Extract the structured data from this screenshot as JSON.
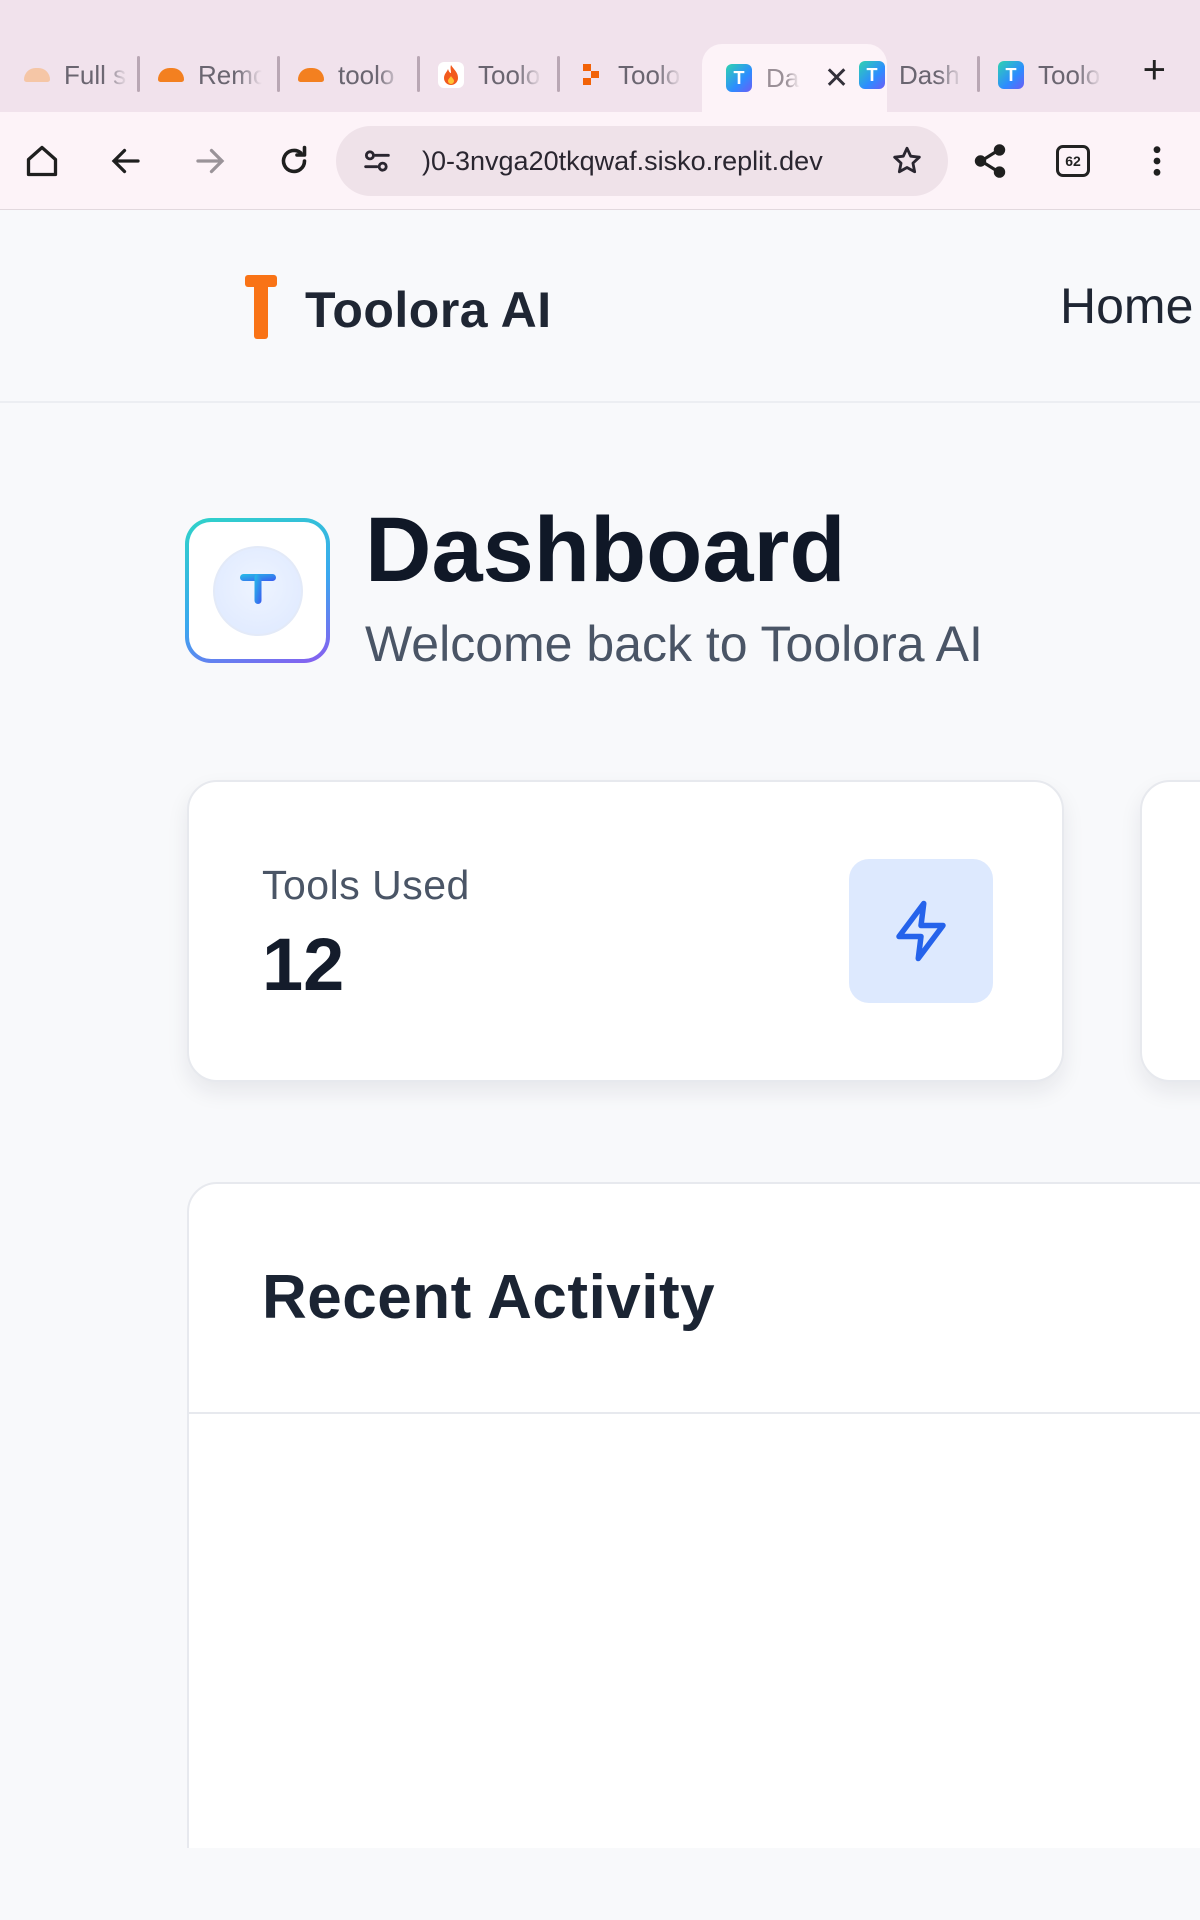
{
  "browser": {
    "tabs": [
      {
        "title": "Full s",
        "favicon": "cloudflare-faded-icon",
        "active": false
      },
      {
        "title": "Remo",
        "favicon": "cloudflare-icon",
        "active": false
      },
      {
        "title": "toolo",
        "favicon": "cloudflare-icon",
        "active": false
      },
      {
        "title": "Toolo",
        "favicon": "flame-icon",
        "active": false
      },
      {
        "title": "Toolo",
        "favicon": "replit-icon",
        "active": false
      },
      {
        "title": "Da",
        "favicon": "toolora-icon",
        "active": true
      },
      {
        "title": "Dash",
        "favicon": "toolora-icon",
        "active": false
      },
      {
        "title": "Toolo",
        "favicon": "toolora-icon",
        "active": false
      }
    ],
    "new_tab_label": "+",
    "url": ")0-3nvga20tkqwaf.sisko.replit.dev",
    "tab_count": "62"
  },
  "site": {
    "brand_name": "Toolora AI",
    "nav_home": "Home"
  },
  "dashboard": {
    "title": "Dashboard",
    "subtitle": "Welcome back to Toolora AI",
    "stats": [
      {
        "label": "Tools Used",
        "value": "12",
        "icon": "lightning-icon"
      }
    ],
    "recent_activity_title": "Recent Activity"
  },
  "colors": {
    "brand_orange": "#f97316",
    "accent_blue": "#2563eb",
    "icon_box_bg": "#dde9fe",
    "text_dark": "#101827",
    "text_muted": "#4a5566"
  }
}
